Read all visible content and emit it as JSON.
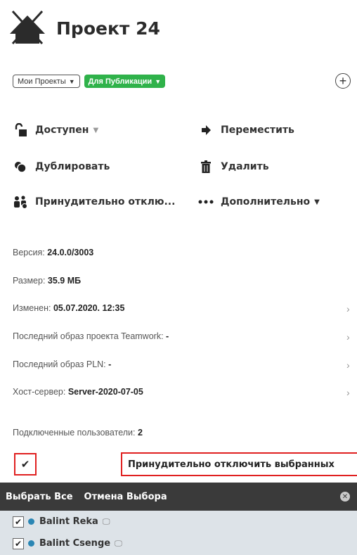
{
  "header": {
    "title": "Проект 24",
    "icon": "project-house-icon"
  },
  "filters": {
    "my_projects": "Мои Проекты",
    "for_publication": "Для Публикации",
    "publication_color": "#2fb24a",
    "add_icon": "plus-circle-icon"
  },
  "actions": {
    "available": "Доступен",
    "move": "Переместить",
    "duplicate": "Дублировать",
    "delete": "Удалить",
    "force_disconnect": "Принудительно отклю...",
    "more": "Дополнительно"
  },
  "info": {
    "version_label": "Версия:",
    "version_value": "24.0.0/3003",
    "size_label": "Размер:",
    "size_value": "35.9 МБ",
    "modified_label": "Изменен:",
    "modified_value": "05.07.2020. 12:35",
    "teamwork_label": "Последний образ проекта Teamwork:",
    "teamwork_value": "-",
    "pln_label": "Последний образ PLN:",
    "pln_value": "-",
    "host_label": "Хост-сервер:",
    "host_value": "Server-2020-07-05",
    "connected_label": "Подключенные пользователи:",
    "connected_value": "2"
  },
  "selection": {
    "force_selected": "Принудительно отключить выбранных",
    "select_all": "Выбрать Все",
    "cancel_selection": "Отмена Выбора",
    "highlight_color": "#e02020"
  },
  "users": [
    {
      "name": "Balint Reka"
    },
    {
      "name": "Balint Csenge"
    }
  ]
}
